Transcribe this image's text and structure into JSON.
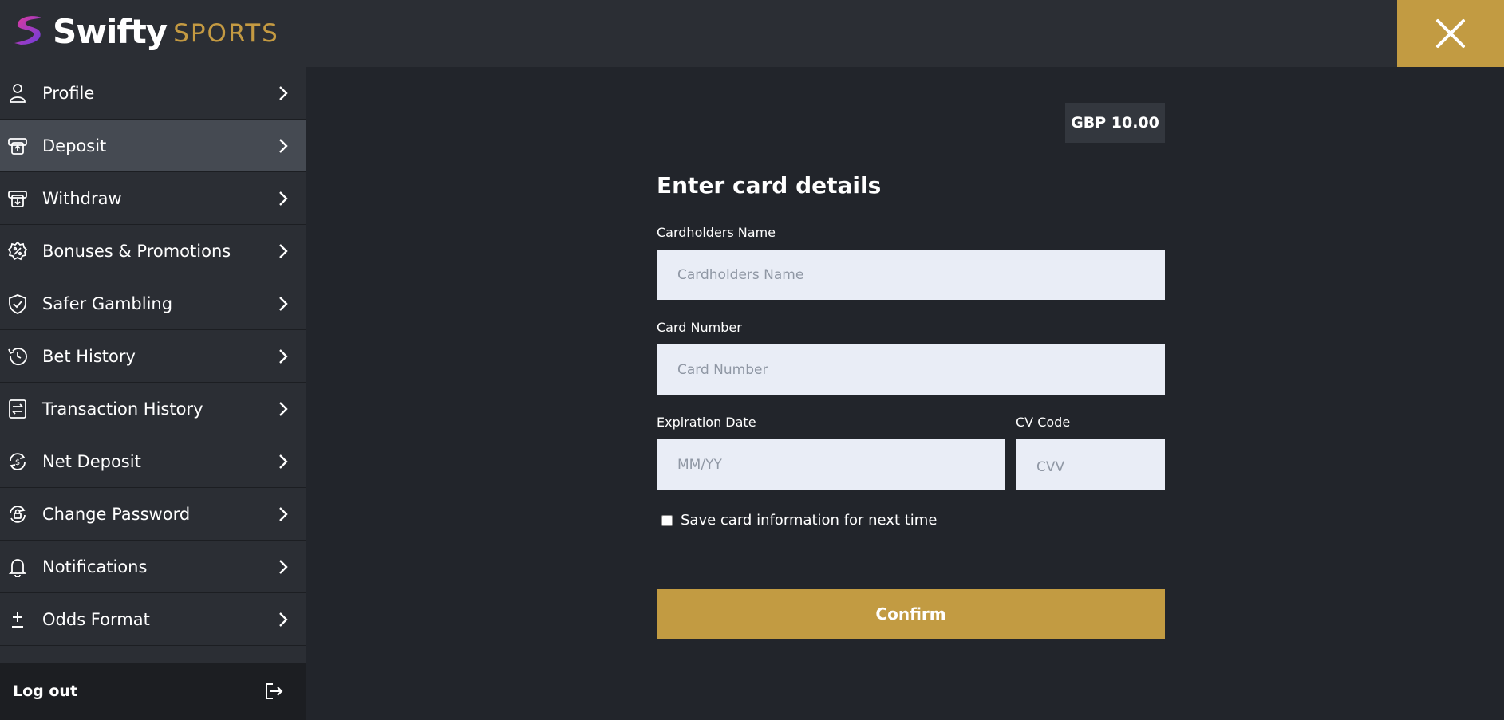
{
  "brand": {
    "name_primary": "Swifty",
    "name_secondary": "SPORTS",
    "accent_color": "#c29b42"
  },
  "header": {
    "close_icon": "close-icon"
  },
  "sidebar": {
    "items": [
      {
        "label": "Profile",
        "icon": "user-icon"
      },
      {
        "label": "Deposit",
        "icon": "deposit-icon",
        "active": true
      },
      {
        "label": "Withdraw",
        "icon": "withdraw-icon"
      },
      {
        "label": "Bonuses & Promotions",
        "icon": "promotion-badge-icon"
      },
      {
        "label": "Safer Gambling",
        "icon": "shield-check-icon"
      },
      {
        "label": "Bet History",
        "icon": "history-icon"
      },
      {
        "label": "Transaction History",
        "icon": "transaction-icon"
      },
      {
        "label": "Net Deposit",
        "icon": "net-deposit-icon"
      },
      {
        "label": "Change Password",
        "icon": "lock-refresh-icon"
      },
      {
        "label": "Notifications",
        "icon": "bell-icon"
      },
      {
        "label": "Odds Format",
        "icon": "plus-minus-icon"
      }
    ],
    "logout_label": "Log out",
    "logout_icon": "logout-icon"
  },
  "main": {
    "amount": "GBP 10.00",
    "title": "Enter card details",
    "fields": {
      "cardholder": {
        "label": "Cardholders Name",
        "placeholder": "Cardholders Name",
        "value": ""
      },
      "card_number": {
        "label": "Card Number",
        "placeholder": "Card Number",
        "value": ""
      },
      "expiry": {
        "label": "Expiration Date",
        "placeholder": "MM/YY",
        "value": ""
      },
      "cvv": {
        "label": "CV Code",
        "placeholder": "CVV",
        "value": ""
      }
    },
    "save_card_label": "Save card information for next time",
    "save_card_checked": false,
    "confirm_label": "Confirm"
  }
}
